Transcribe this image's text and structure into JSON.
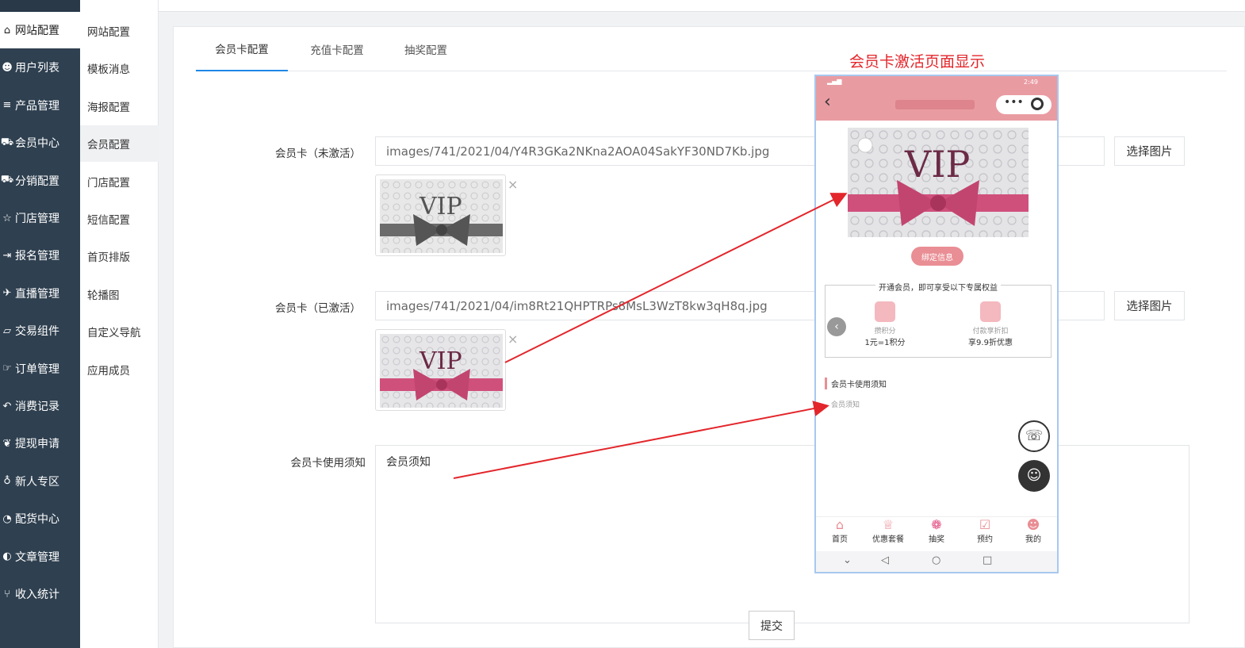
{
  "sidebar": {
    "items": [
      {
        "label": "网站配置",
        "icon": "home-icon",
        "active": true
      },
      {
        "label": "用户列表",
        "icon": "user-icon"
      },
      {
        "label": "产品管理",
        "icon": "list-icon"
      },
      {
        "label": "会员中心",
        "icon": "cart-icon"
      },
      {
        "label": "分销配置",
        "icon": "cart-icon"
      },
      {
        "label": "门店管理",
        "icon": "star-icon"
      },
      {
        "label": "报名管理",
        "icon": "signin-icon"
      },
      {
        "label": "直播管理",
        "icon": "plane-icon"
      },
      {
        "label": "交易组件",
        "icon": "eraser-icon"
      },
      {
        "label": "订单管理",
        "icon": "hand-icon"
      },
      {
        "label": "消费记录",
        "icon": "reply-icon"
      },
      {
        "label": "提现申请",
        "icon": "wechat-icon"
      },
      {
        "label": "新人专区",
        "icon": "pin-icon"
      },
      {
        "label": "配货中心",
        "icon": "pie-icon"
      },
      {
        "label": "文章管理",
        "icon": "contrast-icon"
      },
      {
        "label": "收入统计",
        "icon": "fork-icon"
      }
    ]
  },
  "submenu": {
    "items": [
      {
        "label": "网站配置"
      },
      {
        "label": "模板消息"
      },
      {
        "label": "海报配置"
      },
      {
        "label": "会员配置",
        "active": true
      },
      {
        "label": "门店配置"
      },
      {
        "label": "短信配置"
      },
      {
        "label": "首页排版"
      },
      {
        "label": "轮播图"
      },
      {
        "label": "自定义导航"
      },
      {
        "label": "应用成员"
      }
    ]
  },
  "tabs": [
    {
      "label": "会员卡配置",
      "active": true
    },
    {
      "label": "充值卡配置"
    },
    {
      "label": "抽奖配置"
    }
  ],
  "form": {
    "inactive_label": "会员卡（未激活）",
    "inactive_path": "images/741/2021/04/Y4R3GKa2NKna2AOA04SakYF30ND7Kb.jpg",
    "active_label": "会员卡（已激活）",
    "active_path": "images/741/2021/04/im8Rt21QHPTRPs8MsL3WzT8kw3qH8q.jpg",
    "pick_label": "选择图片",
    "close_glyph": "×",
    "notice_label": "会员卡使用须知",
    "notice_value": "会员须知",
    "submit_label": "提交",
    "vip_text": "VIP"
  },
  "phone": {
    "annotation": "会员卡激活页面显示",
    "status_time": "2:49",
    "bind_button": "绑定信息",
    "benefit_title": "开通会员，即可享受以下专属权益",
    "benefits": [
      {
        "title": "攒积分",
        "desc": "1元=1积分"
      },
      {
        "title": "付款享折扣",
        "desc": "享9.9折优惠"
      }
    ],
    "notice_title": "会员卡使用须知",
    "notice_text": "会员须知",
    "tabbar": [
      "首页",
      "优惠套餐",
      "抽奖",
      "预约",
      "我的"
    ],
    "accent": "#e99ba2"
  },
  "colors": {
    "sidebar_bg": "#2f4050",
    "tab_active": "#1e88e5",
    "arrow": "#e3262b"
  }
}
